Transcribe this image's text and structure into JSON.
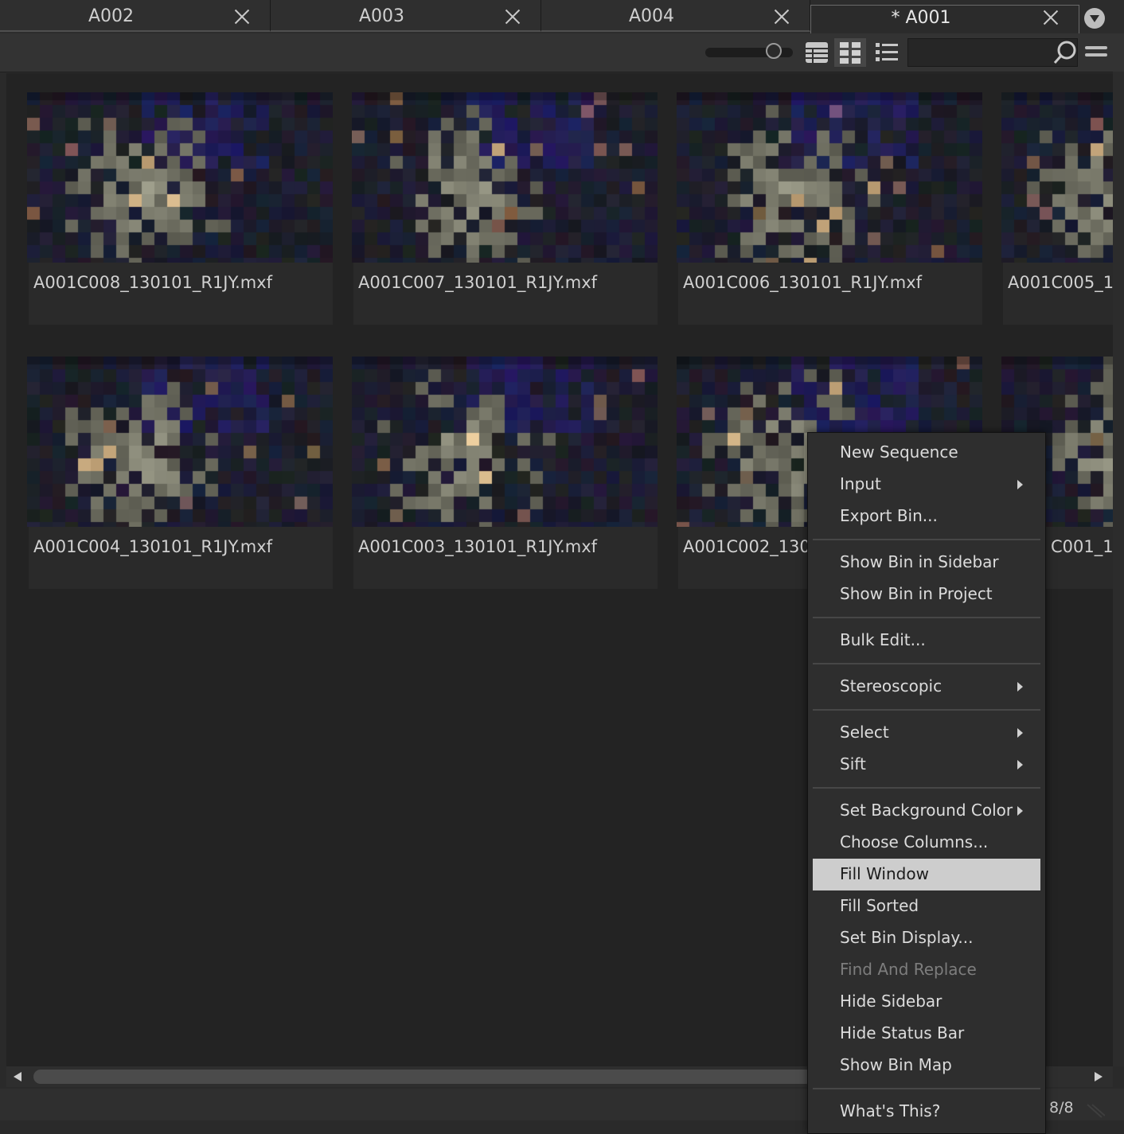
{
  "tabs": [
    {
      "label": "A002"
    },
    {
      "label": "A003"
    },
    {
      "label": "A004"
    },
    {
      "label": "* A001",
      "active": true
    }
  ],
  "toolbar": {
    "icons": [
      "zoom-slider",
      "table-view-icon",
      "thumbnail-view-icon",
      "list-view-icon",
      "search-icon",
      "options-icon"
    ],
    "active_view": "thumbnail-view-icon"
  },
  "clips": [
    {
      "name": "A001C008_130101_R1JY.mxf"
    },
    {
      "name": "A001C007_130101_R1JY.mxf"
    },
    {
      "name": "A001C006_130101_R1JY.mxf"
    },
    {
      "name": "A001C005_1"
    },
    {
      "name": "A001C004_130101_R1JY.mxf"
    },
    {
      "name": "A001C003_130101_R1JY.mxf"
    },
    {
      "name": "A001C002_130"
    },
    {
      "name": "C001_1"
    }
  ],
  "context_menu": {
    "items": [
      {
        "label": "New Sequence"
      },
      {
        "label": "Input",
        "submenu": true
      },
      {
        "label": "Export Bin..."
      },
      {
        "label": "Show Bin in Sidebar"
      },
      {
        "label": "Show Bin in Project"
      },
      {
        "label": "Bulk Edit..."
      },
      {
        "label": "Stereoscopic",
        "submenu": true
      },
      {
        "label": "Select",
        "submenu": true
      },
      {
        "label": "Sift",
        "submenu": true
      },
      {
        "label": "Set Background Color",
        "submenu": true
      },
      {
        "label": "Choose Columns..."
      },
      {
        "label": "Fill Window",
        "highlighted": true
      },
      {
        "label": "Fill Sorted"
      },
      {
        "label": "Set Bin Display..."
      },
      {
        "label": "Find And Replace",
        "disabled": true
      },
      {
        "label": "Hide Sidebar"
      },
      {
        "label": "Hide Status Bar"
      },
      {
        "label": "Show Bin Map"
      },
      {
        "label": "What's This?"
      }
    ]
  },
  "status": {
    "count": "8/8"
  },
  "colors": {
    "background": "#2a2a2a",
    "bin_background": "#232323",
    "menu_highlight": "#cdcdcd"
  }
}
